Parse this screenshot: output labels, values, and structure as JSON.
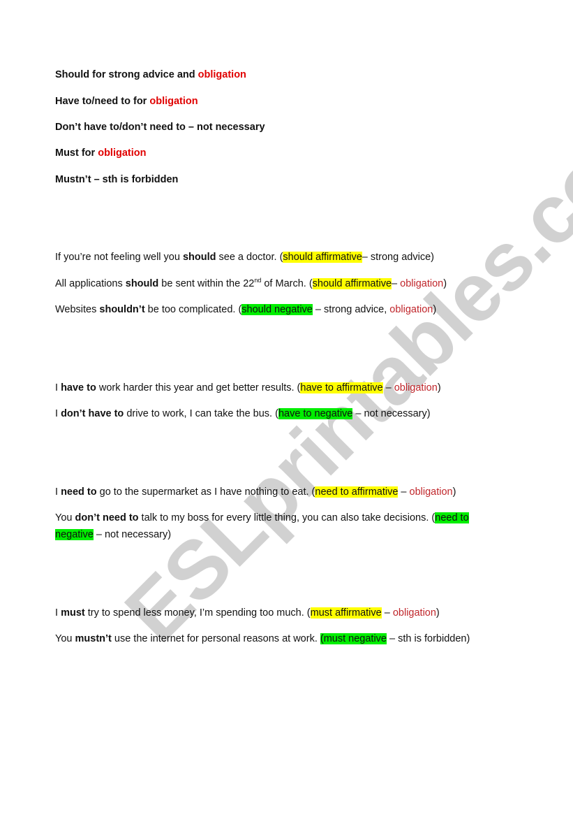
{
  "watermark": "ESLprintables.com",
  "colors": {
    "obligation_red": "#c00000",
    "affirmative_highlight": "#ffff00",
    "negative_highlight": "#00ee00"
  },
  "rules": [
    {
      "text": "Should for strong advice and ",
      "red": "obligation"
    },
    {
      "text": "Have to/need to for ",
      "red": "obligation"
    },
    {
      "text": "Don’t have to/don’t need to – not necessary",
      "red": ""
    },
    {
      "text": "Must for ",
      "red": "obligation"
    },
    {
      "text": "Mustn’t – sth is forbidden",
      "red": ""
    }
  ],
  "examples": {
    "should_1": {
      "pre": " If you’re not feeling well you ",
      "bold": "should",
      "post": " see a doctor. (",
      "hl": "should  affirmative",
      "after": "– strong advice)"
    },
    "should_2": {
      "pre": "All applications ",
      "bold": "should",
      "post": " be sent within the 22",
      "sup": "nd",
      "post2": " of March. (",
      "hl": "should  affirmative",
      "after": "– ",
      "red": "obligation",
      "close": ")"
    },
    "should_3": {
      "pre": " Websites ",
      "bold": "shouldn’t",
      "post": " be too complicated. (",
      "hl": "should negative",
      "after": " – strong advice, ",
      "red": "obligation",
      "close": ")"
    },
    "have_1": {
      "pre": "I ",
      "bold": "have to",
      "post": " work harder this year and get better results. (",
      "hl": "have to affirmative",
      "after": " – ",
      "red": "obligation",
      "close": ")"
    },
    "have_2": {
      "pre": "I ",
      "bold": "don’t have to",
      "post": " drive to work, I can take the bus. (",
      "hl": "have to negative",
      "after": " – not necessary)"
    },
    "need_1": {
      "pre": "I ",
      "bold": "need to",
      "post": " go to the supermarket as I have nothing to eat. (",
      "hl": "need to affirmative",
      "after": " – ",
      "red": "obligation",
      "close": ")"
    },
    "need_2": {
      "pre": "You ",
      "bold": "don’t need to",
      "post": " talk to my boss for every little thing, you can also take decisions. (",
      "hl": "need to",
      "hl2": "negative",
      "after": " – not necessary)"
    },
    "must_1": {
      "pre": "I ",
      "bold": "must",
      "post": " try to spend less money, I’m spending too much. (",
      "hl": "must affirmative",
      "after": " – ",
      "red": "obligation",
      "close": ")"
    },
    "must_2": {
      "pre": "You ",
      "bold": "mustn’t",
      "post": " use the internet for personal reasons at work. ",
      "hl": "(must negative",
      "after": " – sth is forbidden)"
    }
  }
}
